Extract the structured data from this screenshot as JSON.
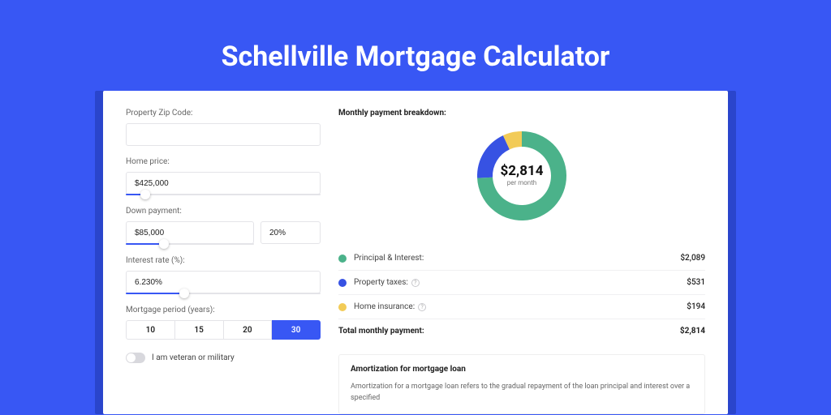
{
  "title": "Schellville Mortgage Calculator",
  "form": {
    "zip": {
      "label": "Property Zip Code:",
      "value": ""
    },
    "home_price": {
      "label": "Home price:",
      "value": "$425,000",
      "slider_pct": 10
    },
    "down_payment": {
      "label": "Down payment:",
      "amount": "$85,000",
      "pct": "20%",
      "slider_pct": 20
    },
    "interest": {
      "label": "Interest rate (%):",
      "value": "6.230%",
      "slider_pct": 30
    },
    "period": {
      "label": "Mortgage period (years):",
      "options": [
        "10",
        "15",
        "20",
        "30"
      ],
      "selected": "30"
    },
    "veteran": {
      "label": "I am veteran or military",
      "on": false
    }
  },
  "breakdown": {
    "heading": "Monthly payment breakdown:",
    "center_amount": "$2,814",
    "center_sub": "per month",
    "items": [
      {
        "label": "Principal & Interest:",
        "value": "$2,089",
        "color": "#4BB28A",
        "info": false
      },
      {
        "label": "Property taxes:",
        "value": "$531",
        "color": "#3752E3",
        "info": true
      },
      {
        "label": "Home insurance:",
        "value": "$194",
        "color": "#F2CB57",
        "info": true
      }
    ],
    "total_label": "Total monthly payment:",
    "total_value": "$2,814"
  },
  "chart_data": {
    "type": "pie",
    "title": "Monthly payment breakdown",
    "series": [
      {
        "name": "Principal & Interest",
        "value": 2089,
        "color": "#4BB28A"
      },
      {
        "name": "Property taxes",
        "value": 531,
        "color": "#3752E3"
      },
      {
        "name": "Home insurance",
        "value": 194,
        "color": "#F2CB57"
      }
    ],
    "total": 2814,
    "center_label": "$2,814 per month"
  },
  "amort": {
    "title": "Amortization for mortgage loan",
    "text": "Amortization for a mortgage loan refers to the gradual repayment of the loan principal and interest over a specified"
  }
}
